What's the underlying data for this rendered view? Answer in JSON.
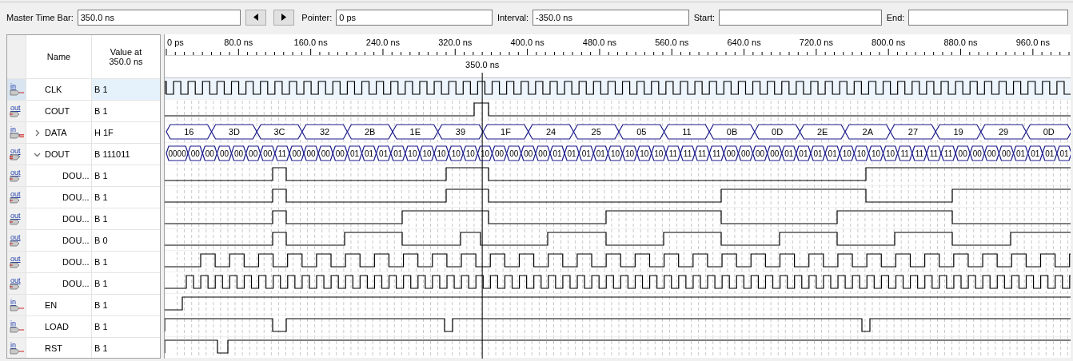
{
  "toolbar": {
    "master_time_bar": {
      "label": "Master Time Bar:",
      "value": "350.0 ns"
    },
    "pointer": {
      "label": "Pointer:",
      "value": "0 ps"
    },
    "interval": {
      "label": "Interval:",
      "value": "-350.0 ns"
    },
    "start": {
      "label": "Start:"
    },
    "end": {
      "label": "End:"
    }
  },
  "columns": {
    "name": "Name",
    "value": "Value at 350.0 ns"
  },
  "timeline": {
    "ticks": [
      "0 ps",
      "80.0 ns",
      "160.0 ns",
      "240.0 ns",
      "320.0 ns",
      "400.0 ns",
      "480.0 ns",
      "560.0 ns",
      "640.0 ns",
      "720.0 ns",
      "800.0 ns",
      "880.0 ns",
      "960.0 ns"
    ],
    "cursor": "350.0 ns"
  },
  "signals": [
    {
      "kind": "bit",
      "direction": "in",
      "name": "CLK",
      "value": "B 1",
      "selected": true
    },
    {
      "kind": "bit",
      "direction": "out",
      "name": "COUT",
      "value": "B 1",
      "selected": false
    },
    {
      "kind": "bus",
      "direction": "in",
      "name": "DATA",
      "value": "H 1F",
      "selected": false,
      "expanded": false,
      "segments": [
        "16",
        "3D",
        "3C",
        "32",
        "2B",
        "1E",
        "39",
        "1F",
        "24",
        "25",
        "05",
        "11",
        "0B",
        "0D",
        "2E",
        "2A",
        "27",
        "19",
        "29",
        "0D"
      ]
    },
    {
      "kind": "bus",
      "direction": "out",
      "name": "DOUT",
      "value": "B 111011",
      "selected": false,
      "expanded": true,
      "segments": [
        "0000",
        "00",
        "00",
        "00",
        "00",
        "00",
        "00",
        "11",
        "00",
        "00",
        "00",
        "00",
        "01",
        "01",
        "01",
        "01",
        "10",
        "10",
        "10",
        "10",
        "10",
        "10",
        "00",
        "00",
        "00",
        "00",
        "01",
        "01",
        "01",
        "01",
        "10",
        "10",
        "10",
        "10",
        "11",
        "11",
        "11",
        "11",
        "00",
        "00",
        "00",
        "00",
        "01",
        "01",
        "01",
        "01",
        "10",
        "10",
        "10",
        "10",
        "11",
        "11",
        "11",
        "11",
        "00",
        "00",
        "00",
        "00",
        "01",
        "01",
        "01",
        "01"
      ],
      "children": [
        {
          "kind": "bit",
          "direction": "out",
          "name": "DOU...",
          "value": "B 1",
          "selected": false
        },
        {
          "kind": "bit",
          "direction": "out",
          "name": "DOU...",
          "value": "B 1",
          "selected": false
        },
        {
          "kind": "bit",
          "direction": "out",
          "name": "DOU...",
          "value": "B 1",
          "selected": false
        },
        {
          "kind": "bit",
          "direction": "out",
          "name": "DOU...",
          "value": "B 0",
          "selected": false
        },
        {
          "kind": "bit",
          "direction": "out",
          "name": "DOU...",
          "value": "B 1",
          "selected": false
        },
        {
          "kind": "bit",
          "direction": "out",
          "name": "DOU...",
          "value": "B 1",
          "selected": false
        }
      ]
    },
    {
      "kind": "bit",
      "direction": "in",
      "name": "EN",
      "value": "B 1",
      "selected": false
    },
    {
      "kind": "bit",
      "direction": "in",
      "name": "LOAD",
      "value": "B 1",
      "selected": false
    },
    {
      "kind": "bit",
      "direction": "in",
      "name": "RST",
      "value": "B 1",
      "selected": false
    }
  ]
}
